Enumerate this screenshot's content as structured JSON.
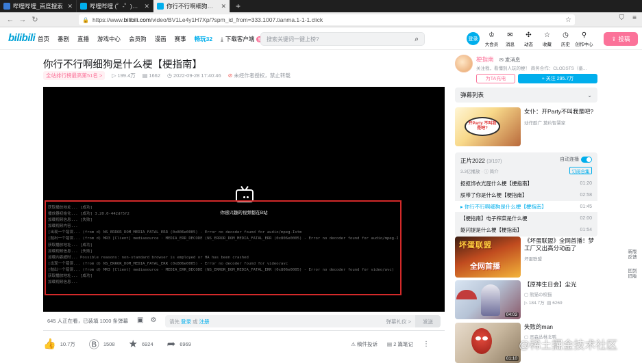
{
  "browser": {
    "tabs": [
      {
        "title": "哔哩哔哩_百度搜索"
      },
      {
        "title": "哔哩哔哩 (゜-゜)つロ 干杯"
      },
      {
        "title": "你行不行啊细狗是什么梗"
      }
    ],
    "new_tab": "+",
    "url_prefix": "https://www.",
    "url_host": "bilibili.com",
    "url_path": "/video/BV1Le4y1H7Xp/?spm_id_from=333.1007.tianma.1-1-1.click"
  },
  "header": {
    "logo": "bilibili",
    "nav": [
      "首页",
      "番剧",
      "直播",
      "游戏中心",
      "会员购",
      "漫画",
      "赛事"
    ],
    "hot": "畅玩32",
    "download": "下载客户端",
    "download_badge": "新",
    "search_placeholder": "搜索关键词一键上榜?",
    "login": "登录",
    "right_nav": [
      {
        "label": "大会员",
        "icon": "vip-icon"
      },
      {
        "label": "消息",
        "icon": "mail-icon"
      },
      {
        "label": "动态",
        "icon": "dynamic-icon"
      },
      {
        "label": "收藏",
        "icon": "star-icon"
      },
      {
        "label": "历史",
        "icon": "history-icon"
      },
      {
        "label": "创作中心",
        "icon": "bulb-icon"
      }
    ],
    "upload": "投稿"
  },
  "video": {
    "title": "你行不行啊细狗是什么梗【梗指南】",
    "rank": "全站排行榜最高第51名 >",
    "views": "199.4万",
    "danmaku_count": "1662",
    "date": "2022-09-28 17:40:46",
    "copyright": "未经作者授权，禁止转载"
  },
  "player": {
    "message": "你感兴趣的视频都在B站",
    "error_lines": [
      "获取播放地址... [成功]",
      "播放器初始化... [成功] 3.20.0-442df5f2",
      "加载视频信息... [失败]",
      "加载视频内容...",
      "[出现一个错误... (from d) NS_ERROR_DOM_MEDIA_FATAL_ERR (0x806e0005) - Error no decoder found for audio/mpeg-Istm",
      "[抛出一个错误... (from d) MR3 [Client] mediasource · MEDIA_ERR_DECODE (NS_ERROR_DOM_MEDIA_FATAL_ERR (0x806e0005) - Error no decoder found for audio/mpeg-Istm)",
      "获取播放地址... [成功]",
      "加载视频信息... [失败]",
      "加载内容超时... Possible reasons: non-standard browser is employed or HA has been crashed",
      "[出现一个错误... (from d) NS_ERROR_DOM_MEDIA_FATAL_ERR (0x806e0005) - Error no decoder found for video/avc",
      "[抛出一个错误... (from d) MR3 [Client] mediasource · MEDIA_ERR_DECODE (NS_ERROR_DOM_MEDIA_FATAL_ERR (0x806e0005) - Error no decoder found for video/avc)",
      "获取播放地址... [成功]",
      "加载视频信息..."
    ]
  },
  "danmaku_bar": {
    "watching": "645 人正在看，已装填 1000 条弹幕",
    "input_prefix": "请先",
    "login": "登录",
    "or": "或",
    "register": "注册",
    "etiquette": "弹幕礼仪 >",
    "send": "发送"
  },
  "actions": {
    "like": "10.7万",
    "coin": "1508",
    "fav": "6924",
    "share": "6969",
    "report": "稿件投诉",
    "notes": "2 篇笔记",
    "more": "⋮"
  },
  "up": {
    "name": "梗指南",
    "message": "发消息",
    "desc": "关注我，看懂別人玩的梗！ 商务合作：CLODSTS（备...",
    "charge": "为TA充电",
    "follow": "+ 关注 295.7万"
  },
  "danmaku_list": {
    "label": "弹幕列表",
    "chevron": "⌄"
  },
  "rec1": {
    "title": "女仆：开Party不叫我是吧?",
    "tag": "动作酷广",
    "author": "莫约智慧家",
    "thumb_text": "开Party 不叫我 是吧?"
  },
  "playlist": {
    "title": "正片2022",
    "count": "(3/197)",
    "autoplay": "自动连播",
    "views": "3.3亿播放",
    "recommend": "简介",
    "subscribe": "订阅合集",
    "items": [
      {
        "title": "抠抠饰衣光屁什么梗【梗指南】",
        "duration": "01:20"
      },
      {
        "title": "朕带了你是什么梗【梗指南】",
        "duration": "02:58"
      },
      {
        "title": "▸ 你行不行啊细狗是什么梗【梗指南】",
        "duration": "01:45"
      },
      {
        "title": "【梗指南】电子榨菜是什么梗",
        "duration": "02:00"
      },
      {
        "title": "躯闪提是什么梗【梗指南】",
        "duration": "01:54"
      }
    ]
  },
  "rec2": {
    "title": "《坏蛋联盟》全网首播！梦工厂又出高分动画了",
    "author": "坏蛋联盟",
    "thumb_title": "坏蛋联盟",
    "thumb_sub": "全网首播"
  },
  "rec3": {
    "title": "【原神生日会】尘光",
    "author": "熊猫の校猫",
    "views": "184.7万",
    "danmaku": "6269",
    "duration": "04:03"
  },
  "rec4": {
    "title": "失败的man",
    "author": "灵森丛林北鸭",
    "duration": "01:10"
  },
  "side": {
    "refresh": "新版反馈",
    "back": "回到旧版"
  },
  "watermark": "@稀土掘金技术社区"
}
